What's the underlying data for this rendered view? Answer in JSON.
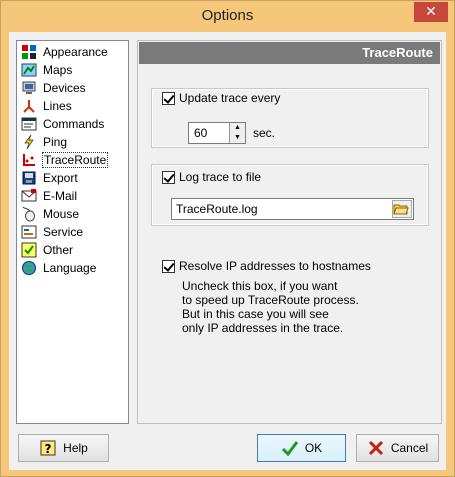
{
  "window": {
    "title": "Options",
    "close_glyph": "✕"
  },
  "sidebar": {
    "items": [
      {
        "label": "Appearance",
        "icon": "appearance-icon"
      },
      {
        "label": "Maps",
        "icon": "maps-icon"
      },
      {
        "label": "Devices",
        "icon": "devices-icon"
      },
      {
        "label": "Lines",
        "icon": "lines-icon"
      },
      {
        "label": "Commands",
        "icon": "commands-icon"
      },
      {
        "label": "Ping",
        "icon": "ping-icon"
      },
      {
        "label": "TraceRoute",
        "icon": "traceroute-icon",
        "selected": true
      },
      {
        "label": "Export",
        "icon": "export-icon"
      },
      {
        "label": "E-Mail",
        "icon": "email-icon"
      },
      {
        "label": "Mouse",
        "icon": "mouse-icon"
      },
      {
        "label": "Service",
        "icon": "service-icon"
      },
      {
        "label": "Other",
        "icon": "other-icon"
      },
      {
        "label": "Language",
        "icon": "language-icon"
      }
    ]
  },
  "panel": {
    "header": "TraceRoute",
    "update_trace": {
      "label": "Update trace every",
      "checked": true,
      "value": "60",
      "unit": "sec."
    },
    "log_trace": {
      "label": "Log trace to file",
      "checked": true,
      "file": "TraceRoute.log"
    },
    "resolve_ip": {
      "label": "Resolve IP addresses to hostnames",
      "checked": true,
      "hint": [
        "Uncheck this box, if you want",
        "to speed up TraceRoute process.",
        "But in this case you will see",
        "only IP addresses in the trace."
      ]
    }
  },
  "buttons": {
    "help": "Help",
    "ok": "OK",
    "cancel": "Cancel"
  },
  "colors": {
    "titlebar": "#f6c77b",
    "close": "#c7473c",
    "header": "#7a7a7a"
  }
}
